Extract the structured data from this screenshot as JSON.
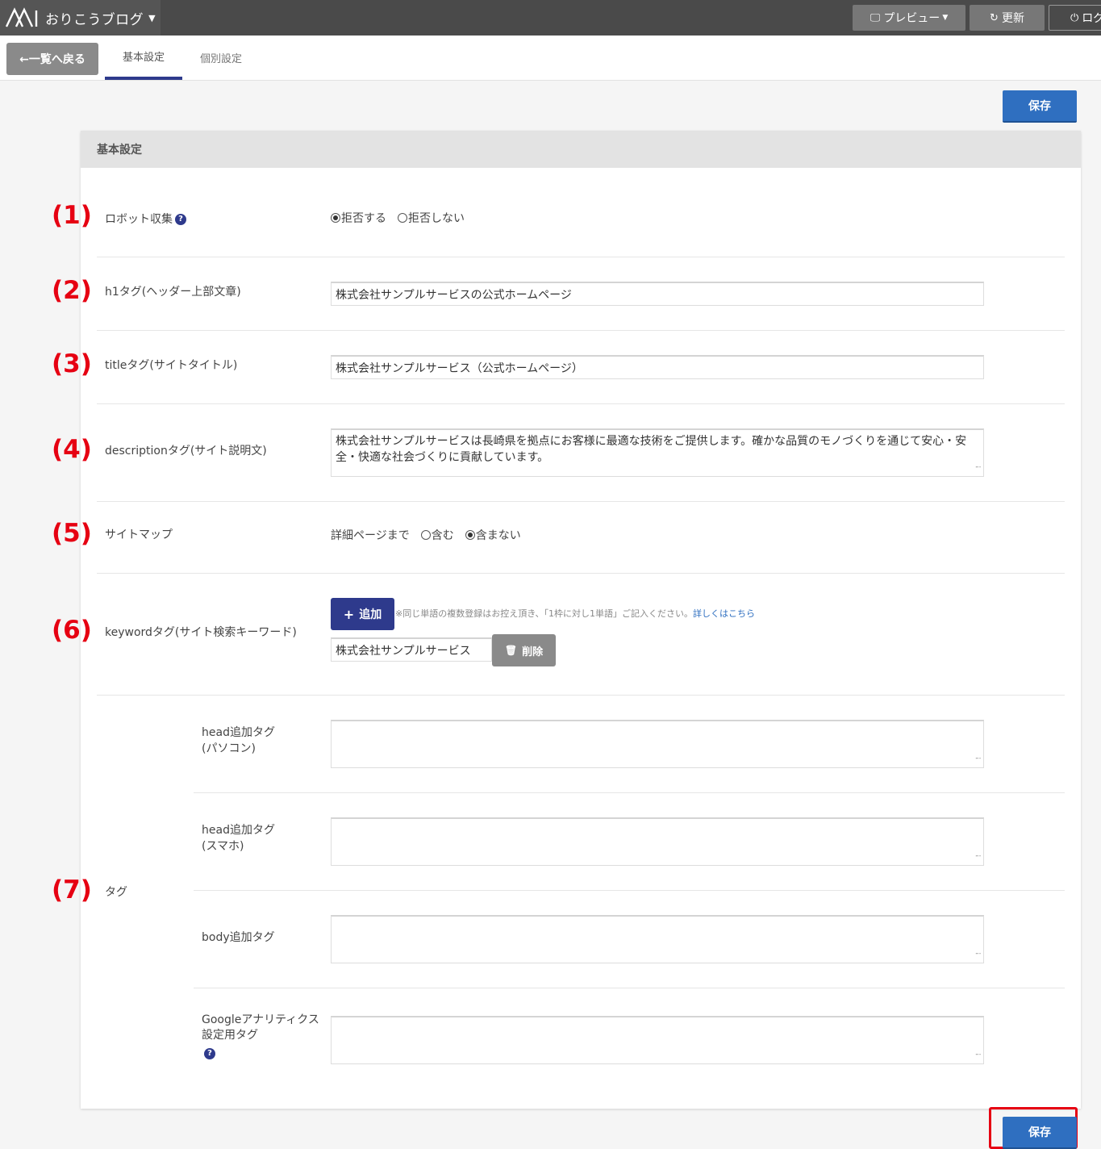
{
  "topbar": {
    "brand_name": "おりこうブログ",
    "preview_label": "プレビュー",
    "refresh_label": "更新",
    "logout_label": "ログ"
  },
  "subnav": {
    "back_label": "←一覧へ戻る",
    "tabs": [
      {
        "label": "基本設定",
        "active": true
      },
      {
        "label": "個別設定",
        "active": false
      }
    ]
  },
  "save_label": "保存",
  "panel": {
    "header": "基本設定"
  },
  "markers": [
    "(1)",
    "(2)",
    "(3)",
    "(4)",
    "(5)",
    "(6)",
    "(7)"
  ],
  "fields": {
    "robots": {
      "label": "ロボット収集",
      "options": [
        "拒否する",
        "拒否しない"
      ],
      "selected": "拒否する"
    },
    "h1": {
      "label": "h1タグ(ヘッダー上部文章)",
      "value": "株式会社サンプルサービスの公式ホームページ"
    },
    "title": {
      "label": "titleタグ(サイトタイトル)",
      "value": "株式会社サンプルサービス（公式ホームページ）"
    },
    "description": {
      "label": "descriptionタグ(サイト説明文)",
      "value": "株式会社サンプルサービスは長崎県を拠点にお客様に最適な技術をご提供します。確かな品質のモノづくりを通じて安心・安全・快適な社会づくりに貢献しています。"
    },
    "sitemap": {
      "label": "サイトマップ",
      "prefix": "詳細ページまで",
      "options": [
        "含む",
        "含まない"
      ],
      "selected": "含まない"
    },
    "keyword": {
      "label": "keywordタグ(サイト検索キーワード)",
      "add_label": "追加",
      "note": "※同じ単語の複数登録はお控え頂き、「1枠に対し1単語」ご記入ください。",
      "note_link": "詳しくはこちら",
      "value": "株式会社サンプルサービス",
      "delete_label": "削除"
    },
    "tags": {
      "label": "タグ",
      "head_pc_line1": "head追加タグ",
      "head_pc_line2": "(パソコン)",
      "head_sp_line1": "head追加タグ",
      "head_sp_line2": "(スマホ)",
      "body_label": "body追加タグ",
      "ga_line1": "Googleアナリティクス",
      "ga_line2": "設定用タグ"
    }
  },
  "colors": {
    "accent": "#2e3a8c",
    "save": "#2f6fc0",
    "marker": "#e60012",
    "topbar": "#4a4a4a"
  }
}
